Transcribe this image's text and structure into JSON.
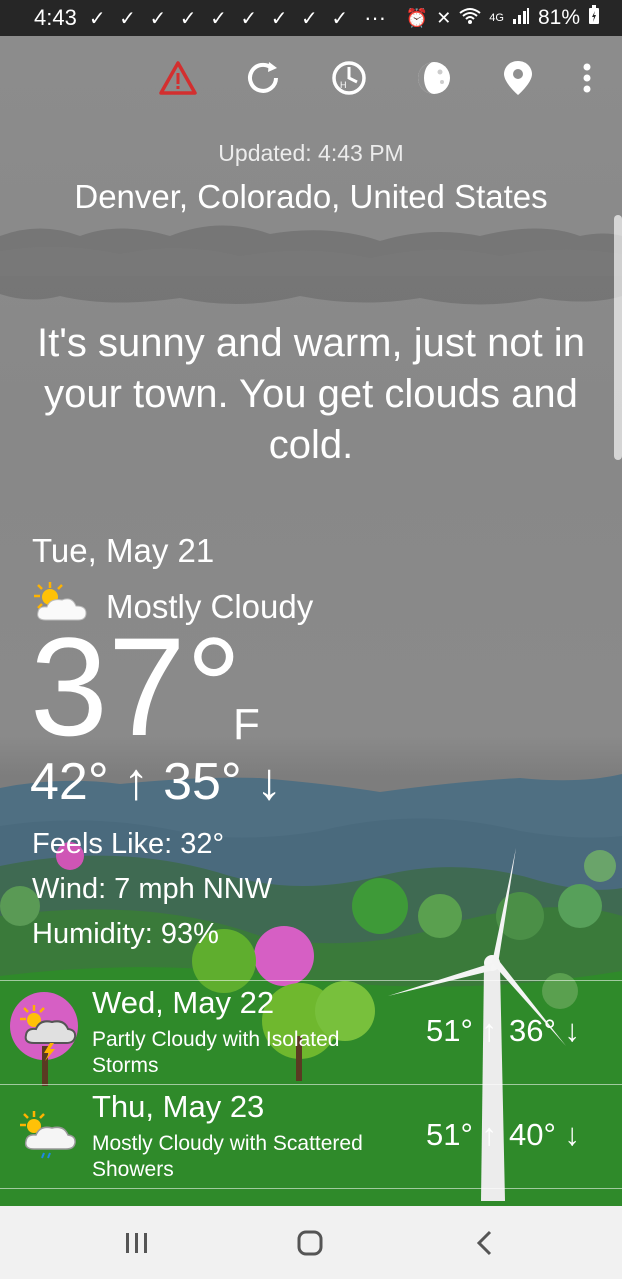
{
  "status_bar": {
    "time": "4:43",
    "notification_marks": "✓ ✓ ✓ ✓ ✓ ✓ ✓ ✓ ✓",
    "overflow": "···",
    "network": "4G",
    "battery": "81%"
  },
  "toolbar": {
    "icons": [
      "alert-icon",
      "refresh-icon",
      "history-icon",
      "moon-phase-icon",
      "location-pin-icon",
      "more-vert-icon"
    ],
    "alert_color": "#d32f2f"
  },
  "header": {
    "updated": "Updated: 4:43 PM",
    "location": "Denver, Colorado, United States"
  },
  "quip": "It's sunny and warm, just not in your town. You get clouds and cold.",
  "current": {
    "date": "Tue, May 21",
    "condition": "Mostly Cloudy",
    "condition_icon": "partly-cloudy-icon",
    "temperature": "37°",
    "unit": "F",
    "high": "42° ↑",
    "low": "35° ↓",
    "feels_like": "Feels Like: 32°",
    "wind": "Wind: 7 mph NNW",
    "humidity": "Humidity: 93%"
  },
  "forecast": [
    {
      "date": "Wed, May 22",
      "description": "Partly Cloudy with Isolated Storms",
      "high": "51° ↑",
      "low": "36° ↓",
      "icon": "thunderstorm-icon"
    },
    {
      "date": "Thu, May 23",
      "description": "Mostly Cloudy with Scattered Showers",
      "high": "51° ↑",
      "low": "40° ↓",
      "icon": "showers-icon"
    }
  ],
  "nav_bar": {
    "buttons": [
      "recents-button",
      "home-button",
      "back-button"
    ]
  }
}
